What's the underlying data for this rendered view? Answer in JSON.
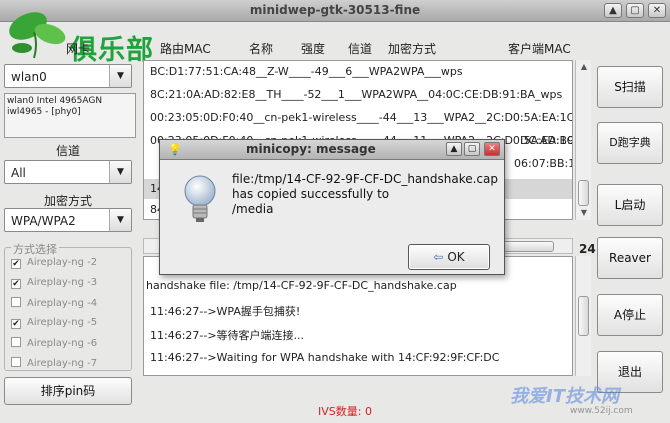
{
  "window": {
    "title": "minidwep-gtk-30513-fine"
  },
  "logo": {
    "text": "俱乐部"
  },
  "columns": {
    "network_card": "网卡",
    "ap_mac": "路由MAC",
    "name": "名称",
    "strength": "强度",
    "channel": "信道",
    "encryption": "加密方式",
    "client_mac": "客户端MAC"
  },
  "interface": {
    "selected": "wlan0",
    "info_line1": "wlan0 Intel 4965AGN",
    "info_line2": "iwl4965 - [phy0]"
  },
  "channel": {
    "label": "信道",
    "selected": "All"
  },
  "encryption": {
    "label": "加密方式",
    "selected": "WPA/WPA2"
  },
  "method_group": {
    "title": "方式选择",
    "items": [
      {
        "label": "Aireplay-ng -2",
        "checked": true
      },
      {
        "label": "Aireplay-ng -3",
        "checked": true
      },
      {
        "label": "Aireplay-ng -4",
        "checked": false
      },
      {
        "label": "Aireplay-ng -5",
        "checked": true
      },
      {
        "label": "Aireplay-ng -6",
        "checked": false
      },
      {
        "label": "Aireplay-ng -7",
        "checked": false
      }
    ]
  },
  "sort_pin_button": "排序pin码",
  "ap_rows": [
    "BC:D1:77:51:CA:48__Z-W____-49___6___WPA2WPA___wps",
    "8C:21:0A:AD:82:E8__TH____-52___1___WPA2WPA__04:0C:CE:DB:91:BA_wps",
    "00:23:05:0D:F0:40__cn-pek1-wireless____-44___13___WPA2__2C:D0:5A:EA:1C:",
    "00:23:05:0D:F0:40__cn-pek1-wireless____-44___11___WPA2__2C:D0:5A:EA:1C:",
    "",
    "14",
    "84",
    ""
  ],
  "ap_partial_right": [
    "DC:AD:B9:7",
    "06:07:BB:11:"
  ],
  "log_lines": [
    "handshake file: /tmp/14-CF-92-9F-CF-DC_handshake.cap",
    "11:46:27-->WPA握手包捕获!",
    "11:46:27-->等待客户端连接...",
    "11:46:27-->Waiting for WPA handshake with 14:CF:92:9F:CF:DC"
  ],
  "side_number": "24",
  "buttons": {
    "scan": "S扫描",
    "dict": "D跑字典",
    "launch": "L启动",
    "reaver": "Reaver",
    "stop": "A停止",
    "exit": "退出"
  },
  "ivs_label": "IVS数量: 0",
  "dialog": {
    "title": "minicopy: message",
    "message_line1": "file:/tmp/14-CF-92-9F-CF-DC_handshake.cap",
    "message_line2": "has copied successfully to",
    "message_line3": "/media",
    "ok_label": "OK"
  },
  "watermark": {
    "text": "我爱IT技术网",
    "url": "www.52ij.com"
  }
}
